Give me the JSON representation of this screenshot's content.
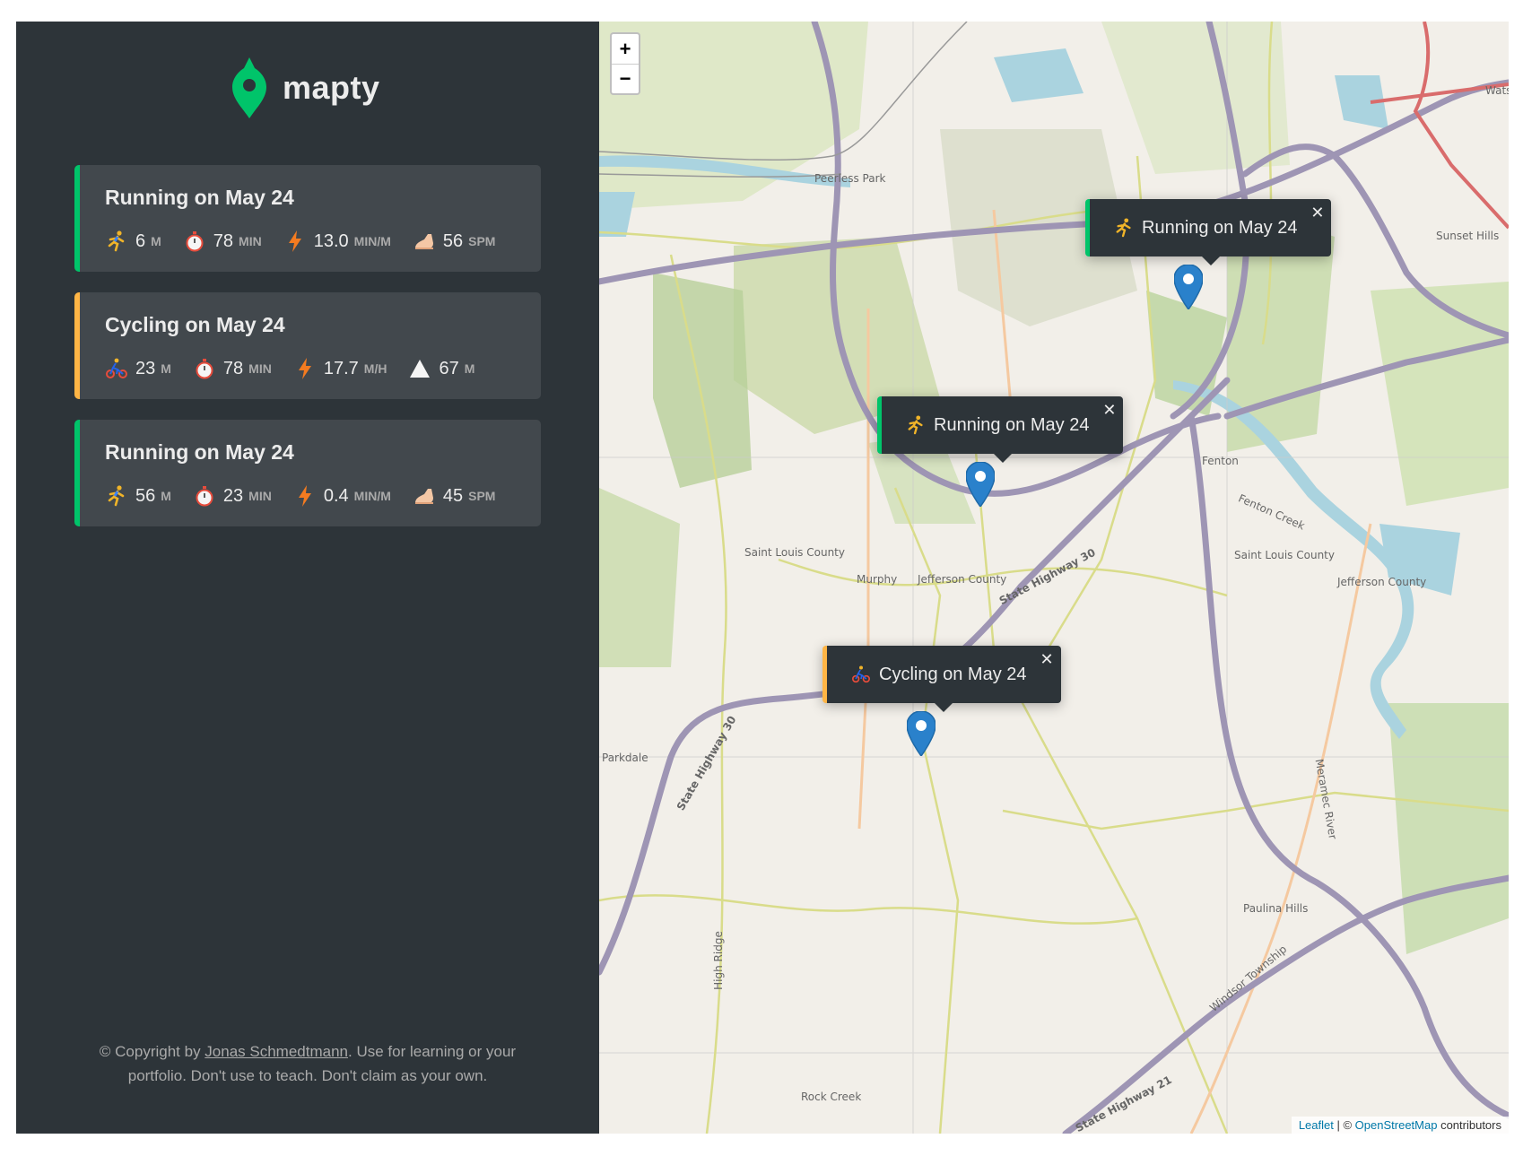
{
  "app": {
    "logo_text": "mapty"
  },
  "workouts": [
    {
      "type": "running",
      "title": "Running on May 24",
      "details": [
        {
          "icon": "runner-icon",
          "value": "6",
          "unit": "m"
        },
        {
          "icon": "stopwatch-icon",
          "value": "78",
          "unit": "min"
        },
        {
          "icon": "lightning-icon",
          "value": "13.0",
          "unit": "min/m"
        },
        {
          "icon": "foot-icon",
          "value": "56",
          "unit": "spm"
        }
      ]
    },
    {
      "type": "cycling",
      "title": "Cycling on May 24",
      "details": [
        {
          "icon": "cyclist-icon",
          "value": "23",
          "unit": "m"
        },
        {
          "icon": "stopwatch-icon",
          "value": "78",
          "unit": "min"
        },
        {
          "icon": "lightning-icon",
          "value": "17.7",
          "unit": "m/h"
        },
        {
          "icon": "mountain-icon",
          "value": "67",
          "unit": "m"
        }
      ]
    },
    {
      "type": "running",
      "title": "Running on May 24",
      "details": [
        {
          "icon": "runner-icon",
          "value": "56",
          "unit": "m"
        },
        {
          "icon": "stopwatch-icon",
          "value": "23",
          "unit": "min"
        },
        {
          "icon": "lightning-icon",
          "value": "0.4",
          "unit": "min/m"
        },
        {
          "icon": "foot-icon",
          "value": "45",
          "unit": "spm"
        }
      ]
    }
  ],
  "footer": {
    "prefix": "© Copyright by ",
    "author": "Jonas Schmedtmann",
    "suffix": ". Use for learning or your portfolio. Don't use to teach. Don't claim as your own."
  },
  "map": {
    "zoom_in": "+",
    "zoom_out": "−",
    "popups": [
      {
        "type": "running",
        "text": "Running on May 24",
        "close": "✕"
      },
      {
        "type": "running",
        "text": "Running on May 24",
        "close": "✕"
      },
      {
        "type": "cycling",
        "text": "Cycling on May 24",
        "close": "✕"
      }
    ],
    "labels": {
      "peerless_park": "Peerless Park",
      "sunset_hills": "Sunset Hills",
      "fenton": "Fenton",
      "fenton_creek": "Fenton Creek",
      "saint_louis_county": "Saint Louis County",
      "jefferson_county": "Jefferson County",
      "murphy": "Murphy",
      "state_highway_30": "State Highway 30",
      "parkdale": "Parkdale",
      "high_ridge": "High Ridge",
      "paulina_hills": "Paulina Hills",
      "windsor_township": "Windsor Township",
      "rock_creek": "Rock Creek",
      "state_highway_21": "State Highway 21",
      "meramec_river": "Meramec River",
      "watson": "Wats"
    },
    "attribution": {
      "leaflet": "Leaflet",
      "sep": " | © ",
      "osm": "OpenStreetMap",
      "suffix": " contributors"
    }
  },
  "colors": {
    "sidebar_bg": "#2d3439",
    "card_bg": "#42484d",
    "running_accent": "#00c46a",
    "cycling_accent": "#ffb545",
    "text_light": "#ececec",
    "text_muted": "#aaaaaa"
  }
}
